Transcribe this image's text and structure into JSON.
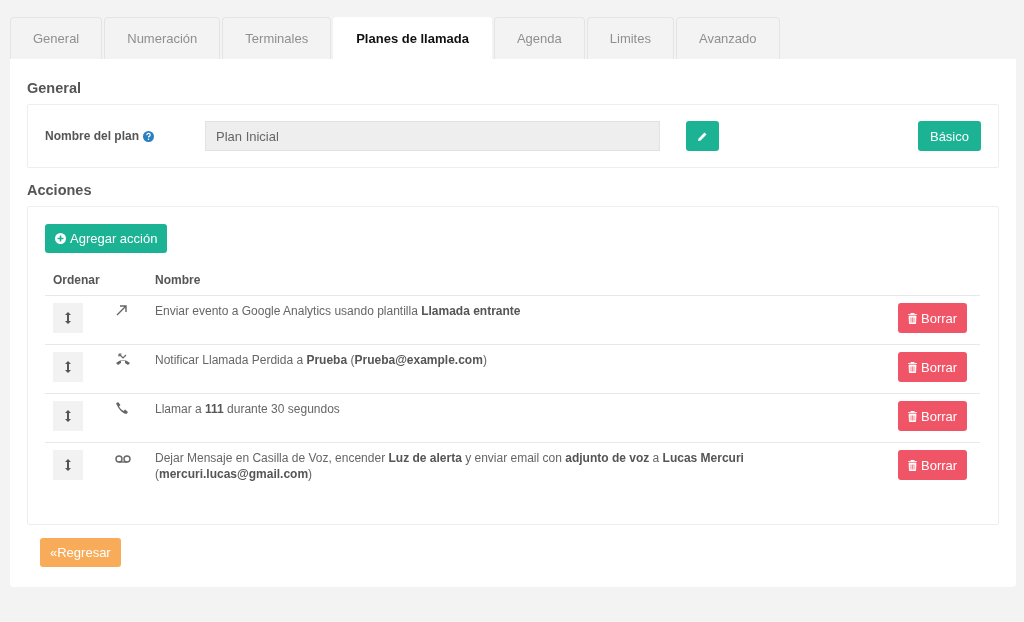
{
  "tabs": [
    {
      "label": "General",
      "selected": false
    },
    {
      "label": "Numeración",
      "selected": false
    },
    {
      "label": "Terminales",
      "selected": false
    },
    {
      "label": "Planes de llamada",
      "selected": true
    },
    {
      "label": "Agenda",
      "selected": false
    },
    {
      "label": "Limites",
      "selected": false
    },
    {
      "label": "Avanzado",
      "selected": false
    }
  ],
  "general": {
    "heading": "General",
    "plan_label": "Nombre del plan",
    "plan_name": "Plan Inicial",
    "mode_button": "Básico"
  },
  "actions": {
    "heading": "Acciones",
    "add_button": "Agregar acción",
    "columns": [
      "Ordenar",
      "Nombre"
    ],
    "rows": [
      {
        "kind": "outbound",
        "text": "Enviar evento a Google Analytics usando plantilla **Llamada entrante**",
        "delete_button": "Borrar"
      },
      {
        "kind": "missed",
        "text": "Notificar Llamada Perdida a **Prueba** (**Prueba@example.com**)",
        "delete_button": "Borrar"
      },
      {
        "kind": "call",
        "text": "Llamar a **111** durante 30 segundos",
        "delete_button": "Borrar"
      },
      {
        "kind": "voicemail",
        "text": "Dejar Mensaje en Casilla de Voz, encender **Luz de alerta** y enviar email con **adjunto de voz** a **Lucas Mercuri** (**mercuri.lucas@gmail.com**)",
        "delete_button": "Borrar"
      }
    ]
  },
  "back_button": "«Regresar"
}
